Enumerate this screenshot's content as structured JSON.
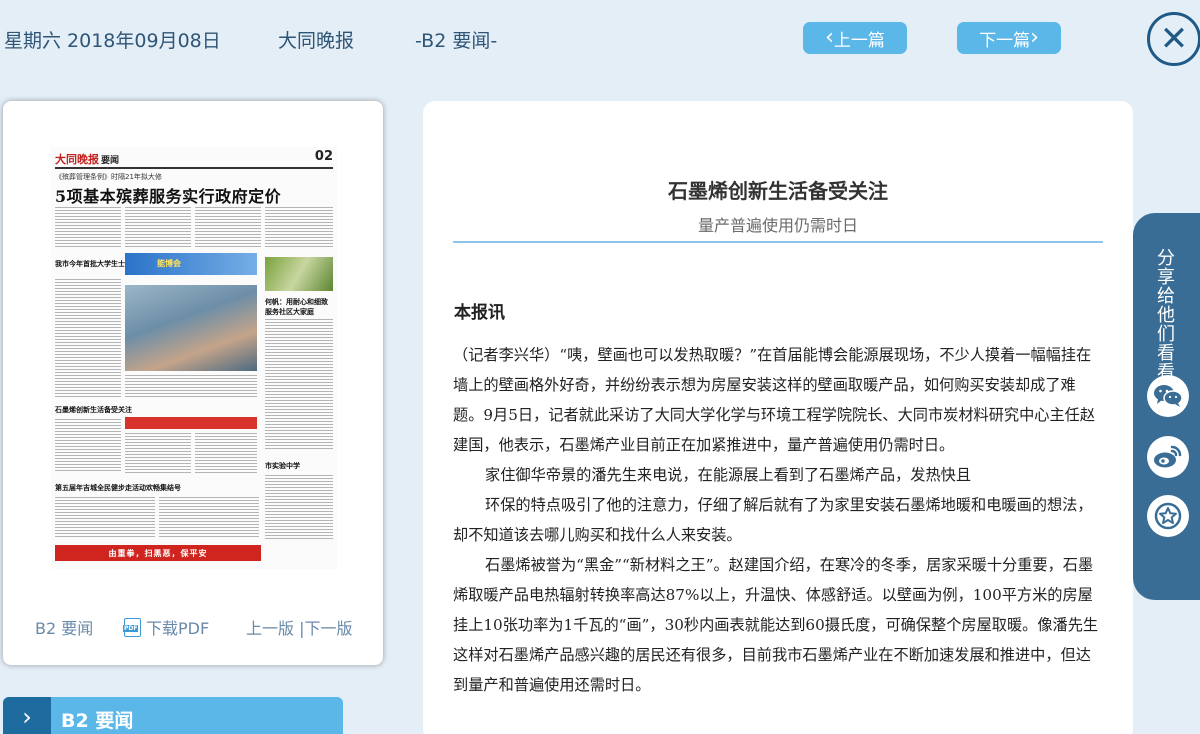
{
  "header": {
    "date": "星期六 2018年09月08日",
    "paper": "大同晚报",
    "section": "-B2 要闻-",
    "prev_label": "上一篇",
    "next_label": "下一篇"
  },
  "thumbnail": {
    "masthead": "大同晚报",
    "section_name": "要闻",
    "page_number": "02",
    "kicker": "《殡葬管理条例》时隔21年拟大修",
    "headline": "5项基本殡葬服务实行政府定价",
    "banner_text": "能博会",
    "subhead_1": "我市今年首批大学生士兵入伍",
    "subhead_2": "石墨烯创新生活备受关注",
    "subhead_3": "第五届年吉城全民健步走活动欢畅集结号",
    "subhead_4": "何帆：用耐心和细致服务社区大家庭",
    "subhead_5": "市实验中学",
    "footer_banner": "由重拳，扫黑恶，保平安"
  },
  "thumb_links": {
    "section": "B2 要闻",
    "download_pdf": "下载PDF",
    "prev_next": "上一版 |下一版"
  },
  "section_tab": {
    "arrow": "›",
    "label": "B2  要闻"
  },
  "article": {
    "title": "石墨烯创新生活备受关注",
    "subtitle": "量产普遍使用仍需时日",
    "lead": "本报讯",
    "paragraphs": [
      "（记者李兴华）“咦，壁画也可以发热取暖？”在首届能博会能源展现场，不少人摸着一幅幅挂在墙上的壁画格外好奇，并纷纷表示想为房屋安装这样的壁画取暖产品，如何购买安装却成了难题。9月5日，记者就此采访了大同大学化学与环境工程学院院长、大同市炭材料研究中心主任赵建国，他表示，石墨烯产业目前正在加紧推进中，量产普遍使用仍需时日。",
      "家住御华帝景的潘先生来电说，在能源展上看到了石墨烯产品，发热快且",
      "环保的特点吸引了他的注意力，仔细了解后就有了为家里安装石墨烯地暖和电暖画的想法，却不知道该去哪儿购买和找什么人来安装。",
      "石墨烯被誉为“黑金”“新材料之王”。赵建国介绍，在寒冷的冬季，居家采暖十分重要，石墨烯取暖产品电热辐射转换率高达87%以上，升温快、体感舒适。以壁画为例，100平方米的房屋挂上10张功率为1千瓦的“画”，30秒内画表就能达到60摄氏度，可确保整个房屋取暖。像潘先生这样对石墨烯产品感兴趣的居民还有很多，目前我市石墨烯产业在不断加速发展和推进中，但达到量产和普遍使用还需时日。"
    ]
  },
  "share": {
    "label": "分享给他们看看",
    "icons": [
      "wechat-icon",
      "weibo-icon",
      "favorite-star-icon"
    ]
  },
  "colors": {
    "background": "#e4eef7",
    "accent": "#5bb7e8",
    "dark_blue": "#1f5a86",
    "share_panel": "#3a6d96"
  }
}
